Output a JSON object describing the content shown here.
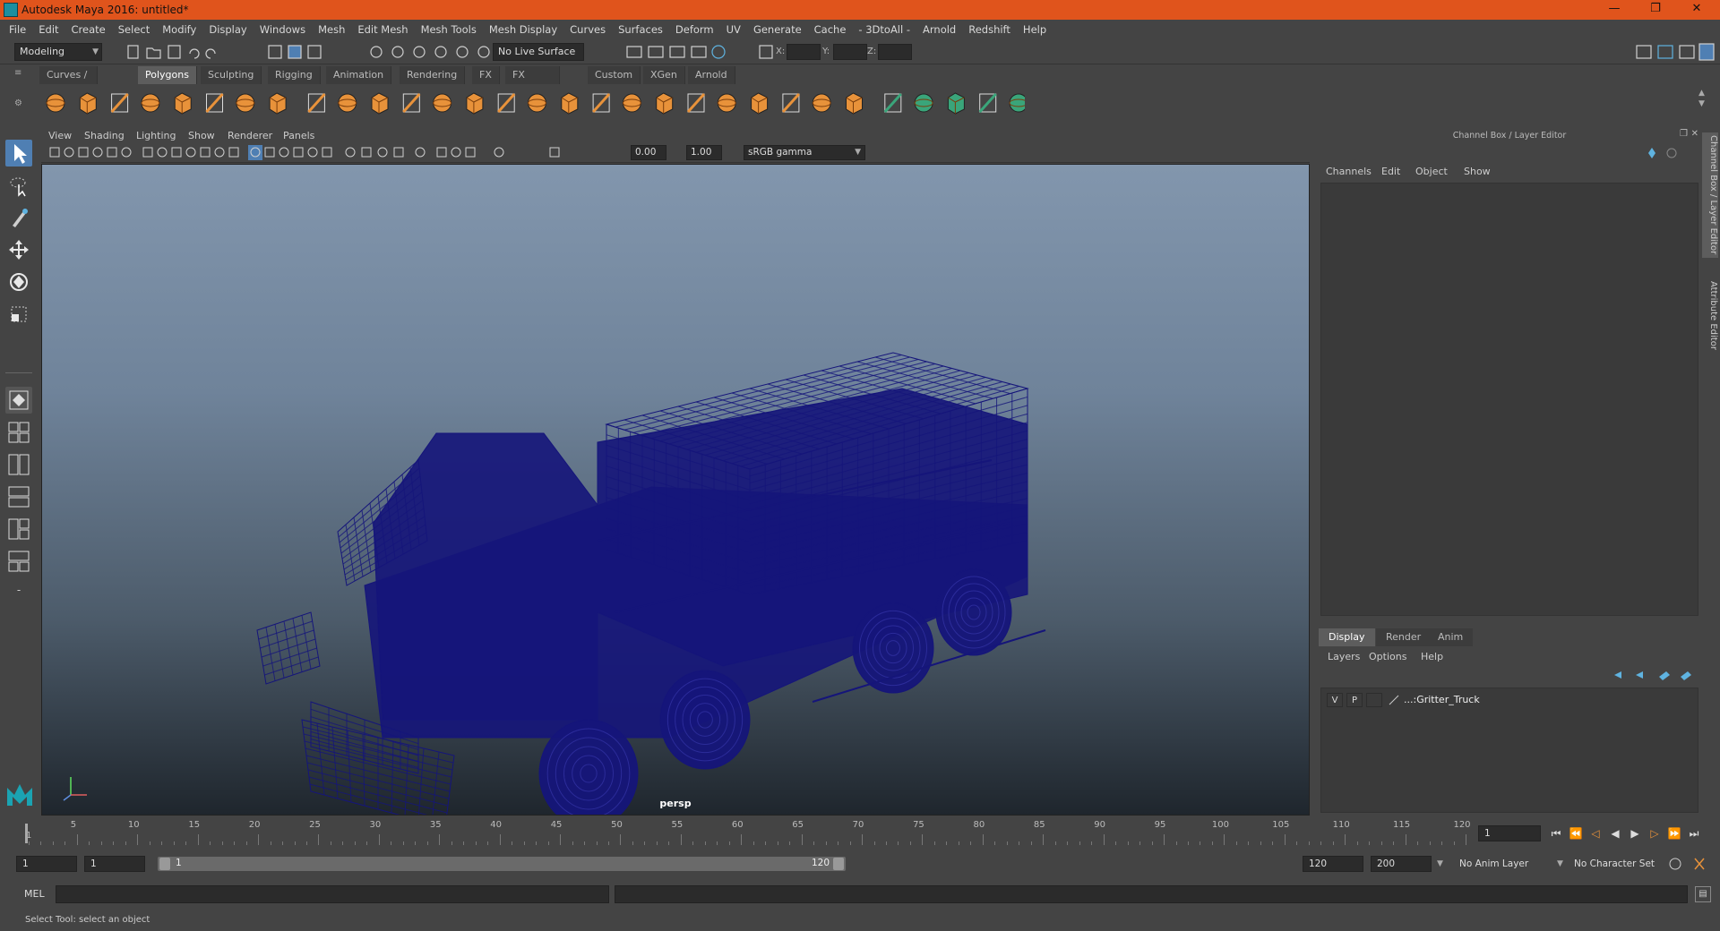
{
  "window": {
    "title": "Autodesk Maya 2016: untitled*",
    "minimize_glyph": "—",
    "restore_glyph": "❐",
    "close_glyph": "✕"
  },
  "menubar": [
    "File",
    "Edit",
    "Create",
    "Select",
    "Modify",
    "Display",
    "Windows",
    "Mesh",
    "Edit Mesh",
    "Mesh Tools",
    "Mesh Display",
    "Curves",
    "Surfaces",
    "Deform",
    "UV",
    "Generate",
    "Cache",
    "- 3DtoAll -",
    "Arnold",
    "Redshift",
    "Help"
  ],
  "statusline": {
    "mode_menu": "Modeling",
    "live_surface": "No Live Surface",
    "x_label": "X:",
    "y_label": "Y:",
    "z_label": "Z:"
  },
  "shelf": {
    "tabs": [
      "Curves / Surfaces",
      "Polygons",
      "Sculpting",
      "Rigging",
      "Animation",
      "Rendering",
      "FX",
      "FX Caching",
      "Custom",
      "XGen",
      "Arnold"
    ],
    "active_tab": "Polygons",
    "accent_orange": "#e8923a",
    "accent_green": "#3aa57a"
  },
  "viewport": {
    "menu": [
      "View",
      "Shading",
      "Lighting",
      "Show",
      "Renderer",
      "Panels"
    ],
    "exposure": "0.00",
    "gamma": "1.00",
    "color_space": "sRGB gamma",
    "camera_label": "persp",
    "wire_color": "#15157a"
  },
  "channel_box": {
    "title": "Channel Box / Layer Editor",
    "menu": [
      "Channels",
      "Edit",
      "Object",
      "Show"
    ]
  },
  "layer_editor": {
    "tabs": [
      "Display",
      "Render",
      "Anim"
    ],
    "active_tab": "Display",
    "menu": [
      "Layers",
      "Options",
      "Help"
    ],
    "layers": [
      {
        "visible": "V",
        "playback": "P",
        "name": "...:Gritter_Truck"
      }
    ]
  },
  "side_tabs": [
    "Channel Box / Layer Editor",
    "Attribute Editor"
  ],
  "timeslider": {
    "ticks": [
      "5",
      "10",
      "15",
      "20",
      "25",
      "30",
      "35",
      "40",
      "45",
      "50",
      "55",
      "60",
      "65",
      "70",
      "75",
      "80",
      "85",
      "90",
      "95",
      "100",
      "105",
      "110",
      "115",
      "120"
    ],
    "first_label": "1",
    "current_frame": "1"
  },
  "range": {
    "start": "1",
    "playback_start": "1",
    "slider_start": "1",
    "slider_end": "120",
    "playback_end": "120",
    "end": "200",
    "anim_layer": "No Anim Layer",
    "character_set": "No Character Set"
  },
  "cmdline": {
    "label": "MEL"
  },
  "helpline": {
    "text": "Select Tool: select an object"
  }
}
